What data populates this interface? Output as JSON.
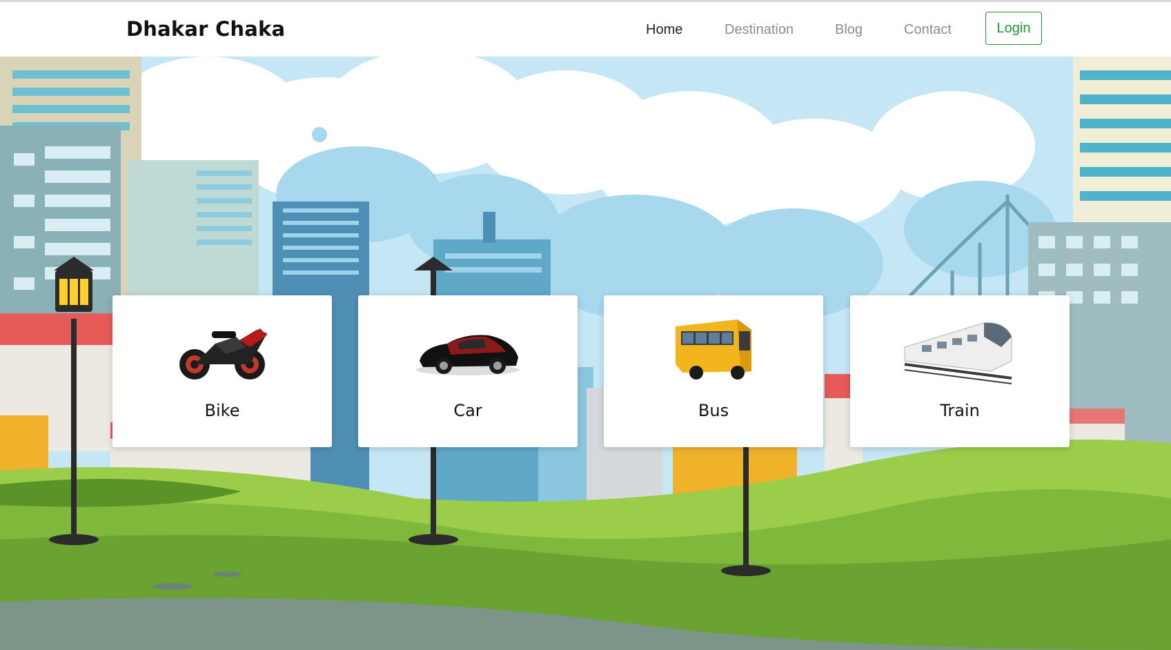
{
  "navbar": {
    "brand": "Dhakar Chaka",
    "links": [
      {
        "label": "Home",
        "active": true
      },
      {
        "label": "Destination",
        "active": false
      },
      {
        "label": "Blog",
        "active": false
      },
      {
        "label": "Contact",
        "active": false
      }
    ],
    "login_label": "Login"
  },
  "colors": {
    "brand_text": "#111111",
    "nav_active": "#222222",
    "nav_inactive": "#8c8c8c",
    "login_accent": "#1a9a3a",
    "sky": "#bde3f3",
    "grass": "#7cb342"
  },
  "cards": [
    {
      "title": "Bike",
      "icon": "motorcycle-icon"
    },
    {
      "title": "Car",
      "icon": "car-icon"
    },
    {
      "title": "Bus",
      "icon": "bus-icon"
    },
    {
      "title": "Train",
      "icon": "train-icon"
    }
  ]
}
